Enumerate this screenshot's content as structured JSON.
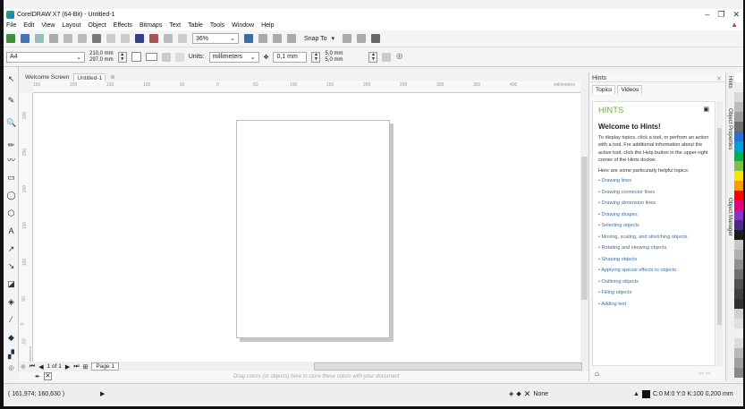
{
  "app": {
    "title": "CorelDRAW X7 (64-Bit) - Untitled-1"
  },
  "menu": [
    "File",
    "Edit",
    "View",
    "Layout",
    "Object",
    "Effects",
    "Bitmaps",
    "Text",
    "Table",
    "Tools",
    "Window",
    "Help"
  ],
  "toolbar1": {
    "zoom": "36%",
    "snap": "Snap To"
  },
  "toolbar2": {
    "paper": "A4",
    "width": "210,0 mm",
    "height": "297,0 mm",
    "units_label": "Units:",
    "units": "millimeters",
    "nudge": "0,1 mm",
    "dup_x": "5,0 mm",
    "dup_y": "5,0 mm"
  },
  "doc_tabs": [
    {
      "label": "Welcome Screen"
    },
    {
      "label": "Untitled-1"
    }
  ],
  "ruler": {
    "h_ticks": [
      "150",
      "200",
      "150",
      "100",
      "50",
      "0",
      "50",
      "100",
      "150",
      "200",
      "250",
      "300",
      "350",
      "400"
    ],
    "h_unit": "millimeters",
    "v_ticks": [
      "300",
      "250",
      "200",
      "150",
      "100",
      "50",
      "0",
      "-50"
    ],
    "v_unit": "millimeters"
  },
  "page_nav": {
    "of": "1 of 1",
    "page_tab": "Page 1"
  },
  "color_bar": {
    "hint": "Drag colors (or objects) here to store these colors with your document"
  },
  "status": {
    "coords": "( 161,974; 160,630 )",
    "outline_none": "None",
    "fill_desc": "C:0 M:0 Y:0 K:100  0,200 mm"
  },
  "hints_panel": {
    "title": "Hints",
    "tabs": [
      "Topics",
      "Videos"
    ],
    "brand": "HINTS",
    "welcome": "Welcome to Hints!",
    "intro": "To display topics, click a tool, or perform an action with a tool. For additional information about the active tool, click the Help button in the upper-right corner of the Hints docker.",
    "lead": "Here are some particularly helpful topics:",
    "topics": [
      "Drawing lines",
      "Drawing connector lines",
      "Drawing dimension lines",
      "Drawing shapes",
      "Selecting objects",
      "Moving, scaling, and stretching objects",
      "Rotating and skewing objects",
      "Shaping objects",
      "Applying special effects to objects",
      "Outlining objects",
      "Filling objects",
      "Adding text"
    ]
  },
  "dock_tabs": [
    "Hints",
    "Object Properties",
    "Object Manager"
  ],
  "palette": [
    "#ffffff",
    "#eeeeee",
    "#d8d8d8",
    "#bdbdbd",
    "#9e9e9e",
    "#6e6e6e",
    "#2b6fd6",
    "#00a0e0",
    "#00b050",
    "#7cc242",
    "#ffe200",
    "#ff9900",
    "#ff0000",
    "#e6007e",
    "#8b2fc9",
    "#4b2a86",
    "#1b1b1b",
    "#c8c8c8",
    "#b0b0b0",
    "#909090",
    "#707070",
    "#505050",
    "#404040",
    "#303030",
    "#d0d0d0",
    "#e0e0e0",
    "#f0f0f0",
    "#dcdcdc",
    "#b8b8b8",
    "#a0a0a0",
    "#888888"
  ]
}
